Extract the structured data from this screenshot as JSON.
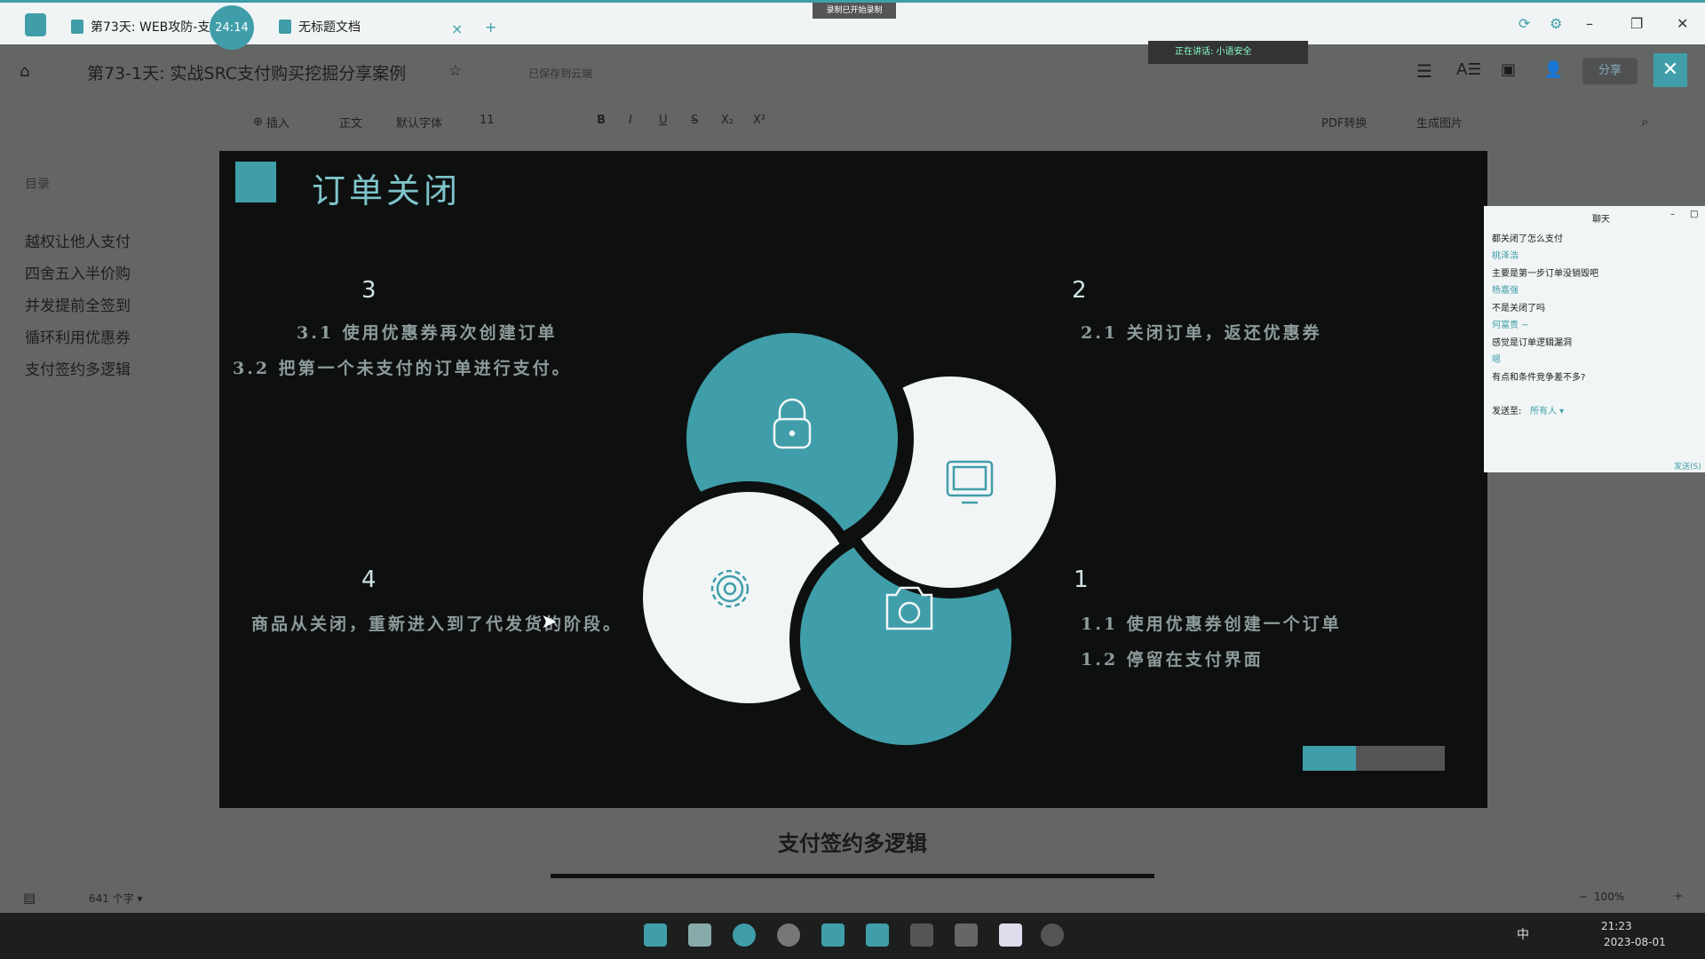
{
  "window": {
    "tabs": [
      {
        "label": "第73天: WEB攻防-支"
      },
      {
        "label": "无标题文档"
      }
    ],
    "timer": "24:14",
    "recording_banner": "录制已开始录制",
    "add_tab": "+",
    "close_tab": "×"
  },
  "doc": {
    "title": "第73-1天: 实战SRC支付购买挖掘分享案例",
    "save_status": "已保存到云端",
    "speaking": "正在讲话: 小语安全",
    "share": "分享"
  },
  "toolbar": {
    "insert": "插入",
    "style": "正文",
    "font": "默认字体",
    "size": "11",
    "pdf": "PDF转换",
    "image": "生成图片",
    "items": [
      "B",
      "I",
      "U",
      "S",
      "X₂",
      "X²"
    ]
  },
  "sidebar": {
    "heading": "目录",
    "items": [
      "越权让他人支付",
      "四舍五入半价购",
      "并发提前全签到",
      "循环利用优惠券",
      "支付签约多逻辑"
    ]
  },
  "slide": {
    "title": "订单关闭",
    "sections": [
      {
        "num": "3",
        "lines": [
          "3.1  使用优惠券再次创建订单",
          "3.2  把第一个未支付的订单进行支付。"
        ]
      },
      {
        "num": "2",
        "lines": [
          "2.1  关闭订单，返还优惠券"
        ]
      },
      {
        "num": "4",
        "lines": [
          "商品从关闭，重新进入到了代发货的阶段。"
        ]
      },
      {
        "num": "1",
        "lines": [
          "1.1  使用优惠券创建一个订单",
          "1.2  停留在支付界面"
        ]
      }
    ],
    "colors": {
      "teal": "#3f9ea9",
      "white": "#f1f5f6",
      "bg": "#0e1010"
    }
  },
  "heading_below": "支付签约多逻辑",
  "chat": {
    "title": "聊天",
    "messages": [
      {
        "text": "都关闭了怎么支付",
        "kind": "msg"
      },
      {
        "text": "桃泽浩",
        "kind": "name"
      },
      {
        "text": "主要是第一步订单没销毁吧",
        "kind": "msg"
      },
      {
        "text": "杨嘉强",
        "kind": "name"
      },
      {
        "text": "不是关闭了吗",
        "kind": "msg"
      },
      {
        "text": "何富贵 ~",
        "kind": "name"
      },
      {
        "text": "感觉是订单逻辑漏洞",
        "kind": "msg"
      },
      {
        "text": "嗯",
        "kind": "name"
      },
      {
        "text": "有点和条件竞争差不多?",
        "kind": "msg"
      }
    ],
    "send_to_label": "发送至:",
    "send_to_value": "所有人 ▾",
    "send": "发送(S)"
  },
  "statusbar": {
    "word_count": "641 个字 ▾",
    "zoom": "100%"
  },
  "clock": {
    "time": "21:23",
    "date": "2023-08-01"
  },
  "tray": {
    "ime": "中"
  }
}
